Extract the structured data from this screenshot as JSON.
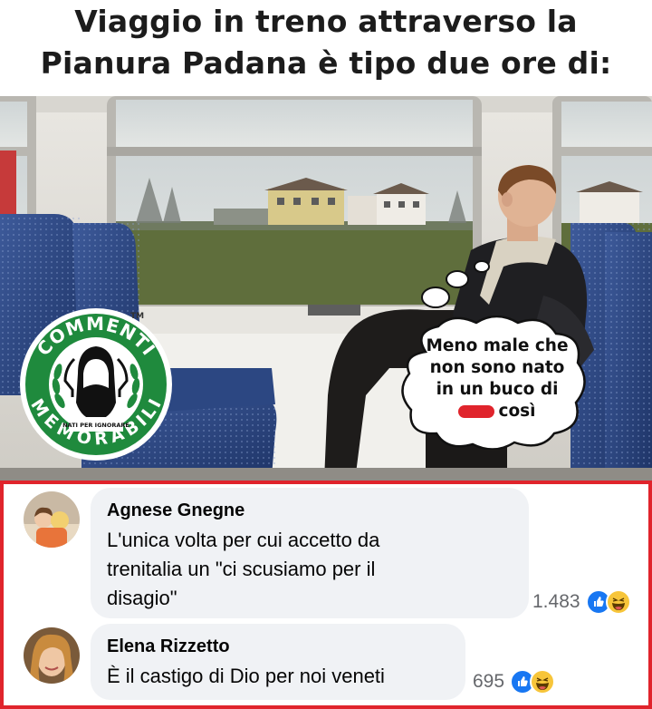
{
  "meme": {
    "title_line1": "Viaggio in treno attraverso la",
    "title_line2": "Pianura Padana è tipo due ore di:",
    "thought_line1": "Meno male che",
    "thought_line2": "non sono nato",
    "thought_line3": "in un buco di",
    "thought_line4_suffix": "così",
    "badge_top": "COMMENTI",
    "badge_bottom": "MEMORABILI",
    "badge_small": "NATI PER IGNORARE",
    "badge_tm": "TM"
  },
  "comments": [
    {
      "author": "Agnese Gnegne",
      "text_lines": [
        "L'unica volta per cui accetto da",
        "trenitalia un \"ci scusiamo per il",
        "disagio\""
      ],
      "reaction_count": "1.483",
      "reactions": [
        "like-icon",
        "haha-icon"
      ]
    },
    {
      "author": "Elena Rizzetto",
      "text_lines": [
        "È il castigo di Dio per noi veneti"
      ],
      "reaction_count": "695",
      "reactions": [
        "like-icon",
        "haha-icon"
      ]
    }
  ],
  "colors": {
    "highlight_border": "#e0242c",
    "badge_green": "#1f8a3d",
    "comment_bubble": "#f0f2f5",
    "like_blue": "#1877f2",
    "haha_yellow": "#f7c53a"
  }
}
